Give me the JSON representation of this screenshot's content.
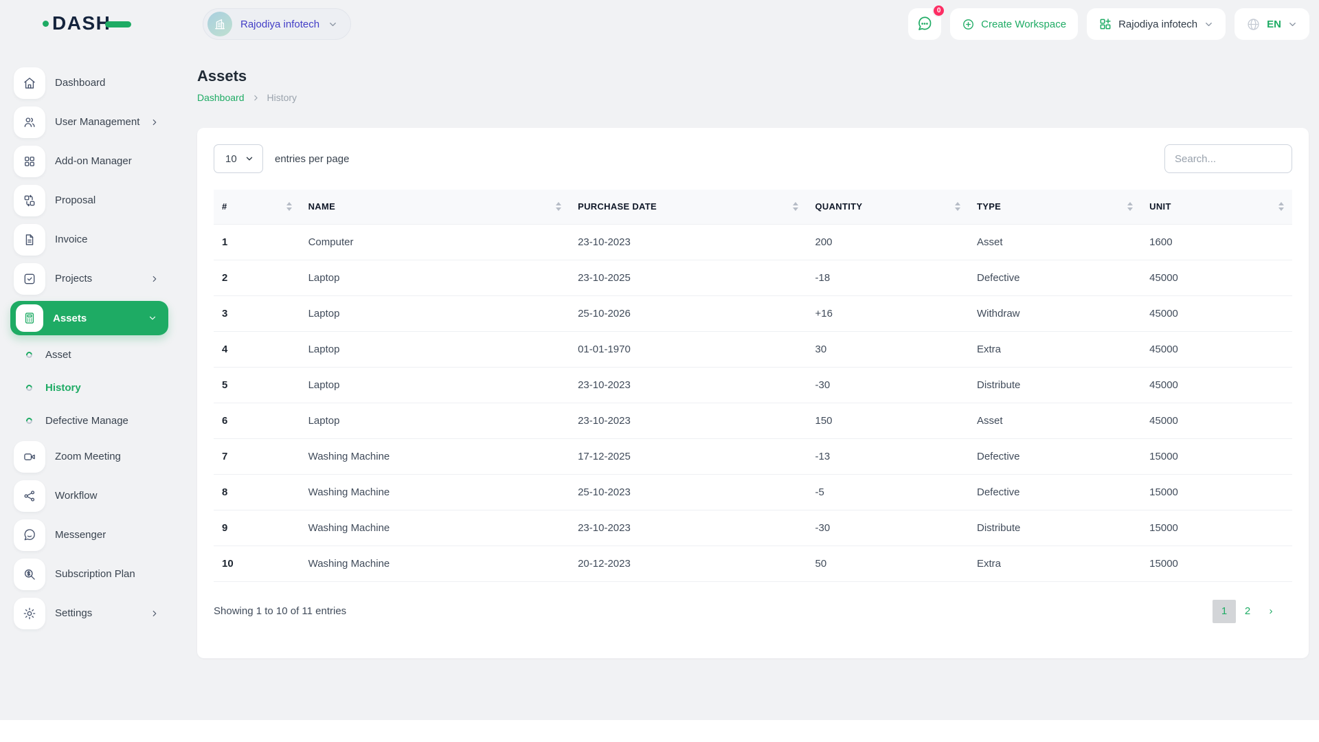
{
  "colors": {
    "primary_green": "#1eab64",
    "workspace_text_indigo": "#423dc6",
    "badge_pink": "#fd2e64",
    "active_page_bg": "#d3d5d8"
  },
  "topbar": {
    "brand": "DASH",
    "workspace_switcher_label": "Rajodiya infotech",
    "notification_count": "0",
    "create_workspace_label": "Create Workspace",
    "workspace_menu_label": "Rajodiya infotech",
    "language_label": "EN"
  },
  "sidebar": {
    "items": [
      {
        "label": "Dashboard"
      },
      {
        "label": "User Management"
      },
      {
        "label": "Add-on Manager"
      },
      {
        "label": "Proposal"
      },
      {
        "label": "Invoice"
      },
      {
        "label": "Projects"
      },
      {
        "label": "Assets"
      },
      {
        "label": "Zoom Meeting"
      },
      {
        "label": "Workflow"
      },
      {
        "label": "Messenger"
      },
      {
        "label": "Subscription Plan"
      },
      {
        "label": "Settings"
      }
    ],
    "assets_children": [
      {
        "label": "Asset"
      },
      {
        "label": "History"
      },
      {
        "label": "Defective Manage"
      }
    ]
  },
  "page": {
    "title": "Assets",
    "breadcrumb_home": "Dashboard",
    "breadcrumb_current": "History"
  },
  "controls": {
    "entries_value": "10",
    "entries_suffix": "entries per page",
    "search_placeholder": "Search..."
  },
  "table": {
    "columns": [
      "#",
      "NAME",
      "PURCHASE DATE",
      "QUANTITY",
      "TYPE",
      "UNIT"
    ],
    "rows": [
      [
        "1",
        "Computer",
        "23-10-2023",
        "200",
        "Asset",
        "1600"
      ],
      [
        "2",
        "Laptop",
        "23-10-2025",
        "-18",
        "Defective",
        "45000"
      ],
      [
        "3",
        "Laptop",
        "25-10-2026",
        "+16",
        "Withdraw",
        "45000"
      ],
      [
        "4",
        "Laptop",
        "01-01-1970",
        "30",
        "Extra",
        "45000"
      ],
      [
        "5",
        "Laptop",
        "23-10-2023",
        "-30",
        "Distribute",
        "45000"
      ],
      [
        "6",
        "Laptop",
        "23-10-2023",
        "150",
        "Asset",
        "45000"
      ],
      [
        "7",
        "Washing Machine",
        "17-12-2025",
        "-13",
        "Defective",
        "15000"
      ],
      [
        "8",
        "Washing Machine",
        "25-10-2023",
        "-5",
        "Defective",
        "15000"
      ],
      [
        "9",
        "Washing Machine",
        "23-10-2023",
        "-30",
        "Distribute",
        "15000"
      ],
      [
        "10",
        "Washing Machine",
        "20-12-2023",
        "50",
        "Extra",
        "15000"
      ]
    ]
  },
  "footer": {
    "summary": "Showing 1 to 10 of 11 entries",
    "pages": [
      "1",
      "2"
    ],
    "next": "›"
  }
}
